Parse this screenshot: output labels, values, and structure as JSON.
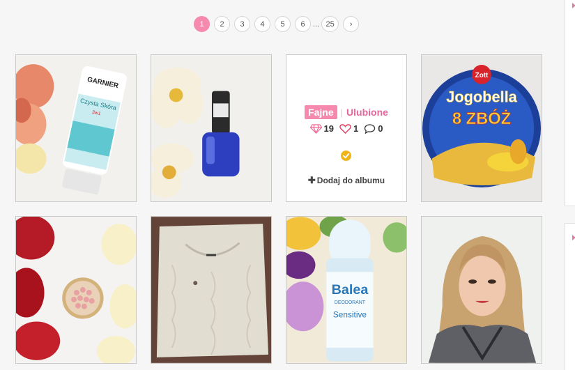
{
  "pagination": {
    "pages": [
      "1",
      "2",
      "3",
      "4",
      "5",
      "6"
    ],
    "ellipsis": "...",
    "last": "25",
    "next": "›"
  },
  "card": {
    "badge_primary": "Fajne",
    "separator": "|",
    "badge_secondary": "Ulubione",
    "gems": "19",
    "likes": "1",
    "comments": "0",
    "add_plus": "✚",
    "add_label": "Dodaj do albumu"
  },
  "photos": {
    "garnier_brand": "GARNIER",
    "garnier_product": "Czysta Skóra",
    "garnier_variant": "3w1",
    "zott_brand": "Zott",
    "yogurt_name": "Jogobella",
    "yogurt_variant": "8 ZBÓŻ",
    "balea_brand": "Balea",
    "balea_type": "DEODORANT",
    "balea_variant": "Sensitive"
  },
  "colors": {
    "accent": "#f58aae",
    "accent_text": "#e2679b",
    "check": "#f0b419"
  }
}
